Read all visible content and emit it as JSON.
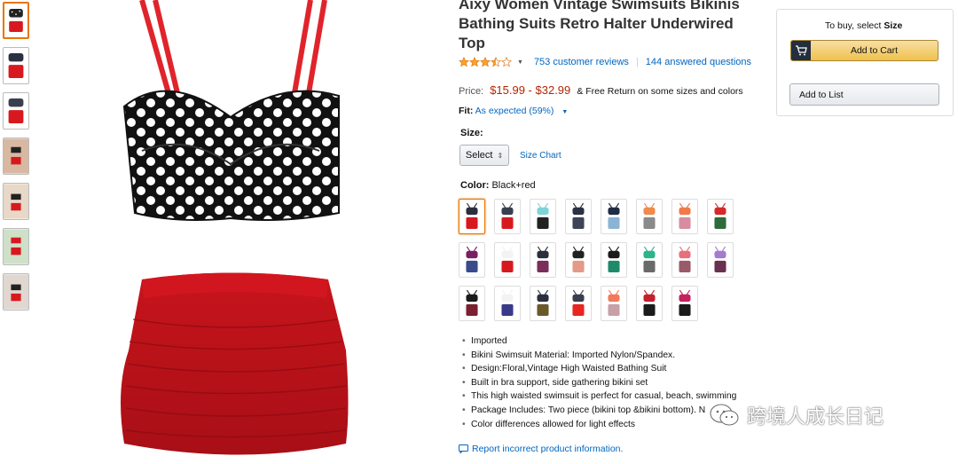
{
  "product": {
    "title": "Aixy Women Vintage Swimsuits Bikinis Bathing Suits Retro Halter Underwired Top",
    "rating": 3.5,
    "reviews_link": "753 customer reviews",
    "questions_link": "144 answered questions",
    "price_label": "Price:",
    "price": "$15.99 - $32.99",
    "price_note": "& Free Return on some sizes and colors",
    "fit_label": "Fit:",
    "fit_value": "As expected (59%)",
    "size_label": "Size:",
    "size_select": "Select",
    "size_chart": "Size Chart",
    "color_label": "Color:",
    "color_value": "Black+red",
    "bullets": [
      "Imported",
      "Bikini Swimsuit Material: Imported Nylon/Spandex.",
      "Design:Floral,Vintage High Waisted Bathing Suit",
      "Built in bra support, side gathering bikini set",
      "This high waisted swimsuit is perfect for casual, beach, swimming",
      "Package Includes: Two piece (bikini top &bikini bottom). N",
      "Color differences allowed for light effects"
    ],
    "report_link": "Report incorrect product information."
  },
  "buybox": {
    "hint_prefix": "To buy, select ",
    "hint_bold": "Size",
    "add_to_cart": "Add to Cart",
    "add_to_list": "Add to List"
  },
  "watermark": "跨境人成长日记",
  "colors": {
    "accent": "#e77600",
    "price": "#b12704",
    "link": "#0066c0",
    "cart_button": "#f0c14b",
    "star": "#ffa41c"
  },
  "swatches": [
    {
      "top": "#2b2f3d",
      "bottom": "#d7191f"
    },
    {
      "top": "#3a3f4f",
      "bottom": "#d7191f"
    },
    {
      "top": "#7fd3d8",
      "bottom": "#222"
    },
    {
      "top": "#2b3142",
      "bottom": "#3c4456"
    },
    {
      "top": "#1f2b44",
      "bottom": "#8ab4d6"
    },
    {
      "top": "#f08a4b",
      "bottom": "#8a8a8a"
    },
    {
      "top": "#f07a4a",
      "bottom": "#d88ca0"
    },
    {
      "top": "#d42a2a",
      "bottom": "#2e6b3a"
    },
    {
      "top": "#7a1e62",
      "bottom": "#3a4a8a"
    },
    {
      "top": "#f3f3f3",
      "bottom": "#d7191f"
    },
    {
      "top": "#2b2f3d",
      "bottom": "#7a2d5a"
    },
    {
      "top": "#222",
      "bottom": "#e39a86"
    },
    {
      "top": "#1b1b1b",
      "bottom": "#1f8a6a"
    },
    {
      "top": "#2bb58a",
      "bottom": "#6a6a6a"
    },
    {
      "top": "#e86f7c",
      "bottom": "#9a5a6a"
    },
    {
      "top": "#a57bd0",
      "bottom": "#6a3050"
    },
    {
      "top": "#1b1b1b",
      "bottom": "#7a2030"
    },
    {
      "top": "#f3f3f3",
      "bottom": "#3a3a8a"
    },
    {
      "top": "#2b2f3d",
      "bottom": "#6a5a2a"
    },
    {
      "top": "#3a3f4f",
      "bottom": "#e8261f"
    },
    {
      "top": "#f07a5a",
      "bottom": "#c8a0a8"
    },
    {
      "top": "#c42030",
      "bottom": "#1b1b1b"
    },
    {
      "top": "#c42060",
      "bottom": "#1b1b1b"
    }
  ]
}
